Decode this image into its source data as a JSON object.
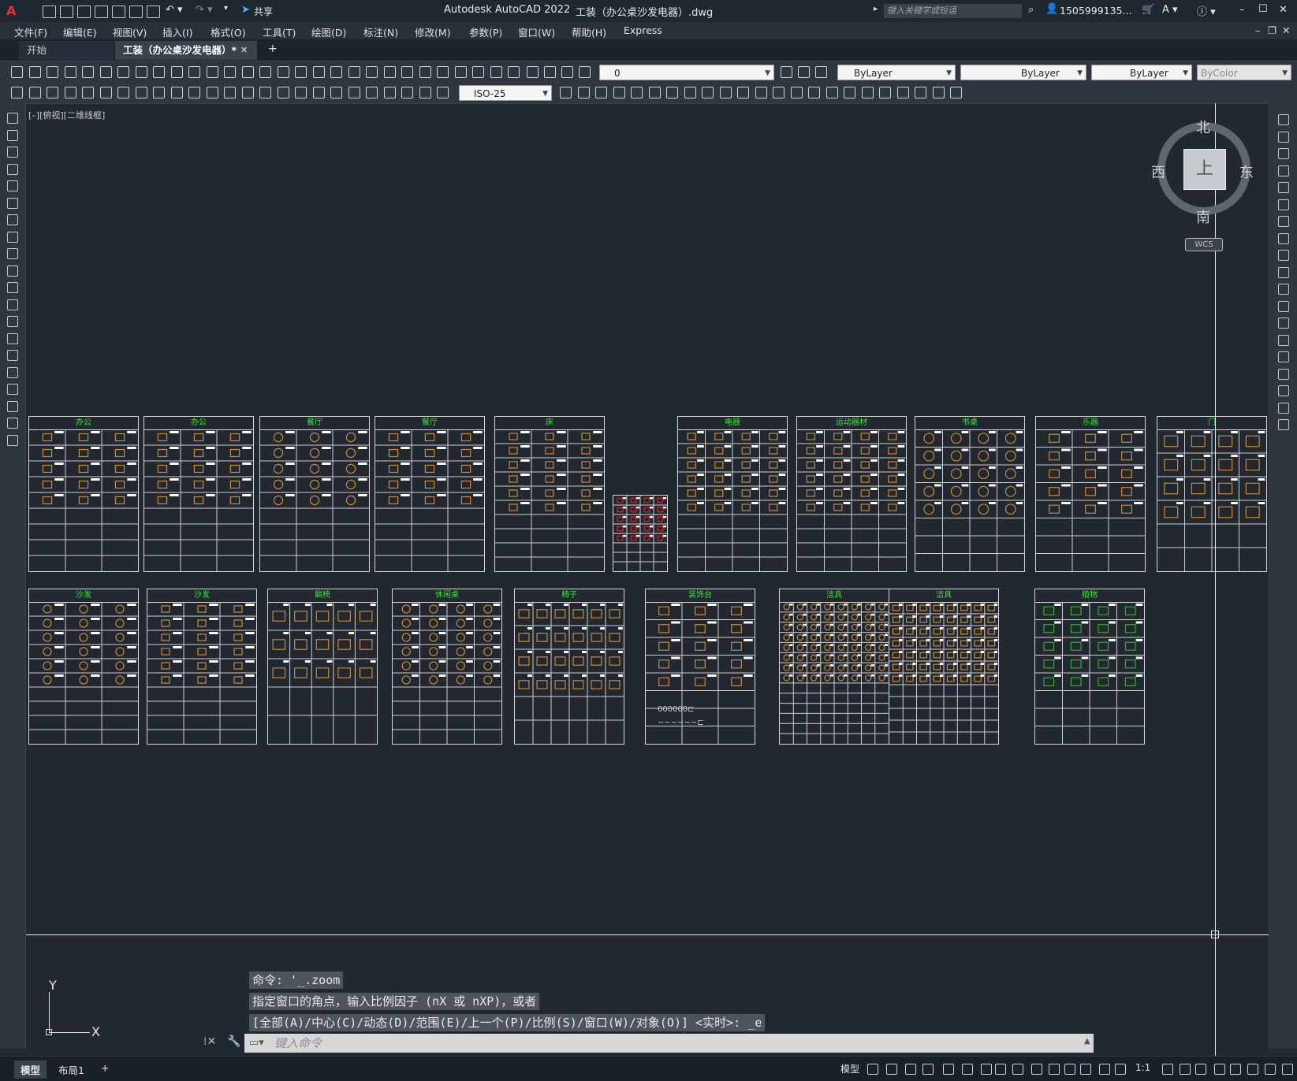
{
  "window": {
    "app_title": "Autodesk AutoCAD 2022",
    "doc_title": "工装（办公桌沙发电器）.dwg",
    "share_label": "共享",
    "search_placeholder": "键入关键字或短语",
    "user": "1505999135...",
    "min": "–",
    "max": "☐",
    "close": "✕"
  },
  "menus": [
    "文件(F)",
    "编辑(E)",
    "视图(V)",
    "插入(I)",
    "格式(O)",
    "工具(T)",
    "绘图(D)",
    "标注(N)",
    "修改(M)",
    "参数(P)",
    "窗口(W)",
    "帮助(H)",
    "Express"
  ],
  "tabs": {
    "start": "开始",
    "active": "工装（办公桌沙发电器）*",
    "close": "✕",
    "add": "+"
  },
  "toolbar": {
    "layer_value": "0",
    "color_value": "ByLayer",
    "linetype_value": "ByLayer",
    "lineweight_value": "ByLayer",
    "plotstyle_value": "ByColor",
    "dimstyle_value": "ISO-25"
  },
  "viewport_label": "[–][俯视][二维线框]",
  "sheets_row1": [
    "办公",
    "办公",
    "餐厅",
    "餐厅",
    "床",
    "电器",
    "运动器材",
    "书桌",
    "乐器",
    "门"
  ],
  "sheets_row2": [
    "沙发",
    "沙发",
    "躺椅",
    "休闲桌",
    "椅子",
    "装饰台",
    "洁具",
    "洁具",
    "植物"
  ],
  "sheet_misc_text": {
    "dec_a": "000000⊏",
    "dec_b": "~~~~~~⊏"
  },
  "navcube": {
    "north": "北",
    "south": "南",
    "east": "东",
    "west": "西",
    "face": "上",
    "wcs": "WCS"
  },
  "ucs": {
    "x": "X",
    "y": "Y"
  },
  "command": {
    "history": [
      "命令: '_.zoom",
      "指定窗口的角点，输入比例因子 (nX 或 nXP)，或者",
      "[全部(A)/中心(C)/动态(D)/范围(E)/上一个(P)/比例(S)/窗口(W)/对象(O)] <实时>: _e"
    ],
    "input_placeholder": "键入命令"
  },
  "status": {
    "model_tab": "模型",
    "layout_tab": "布局1",
    "add": "+",
    "model_btn": "模型",
    "scale": "1:1"
  },
  "colors": {
    "bg": "#212830",
    "accent_green": "#39e639",
    "sheet_line": "#d8d8d8",
    "furniture": "#c98a3a"
  }
}
